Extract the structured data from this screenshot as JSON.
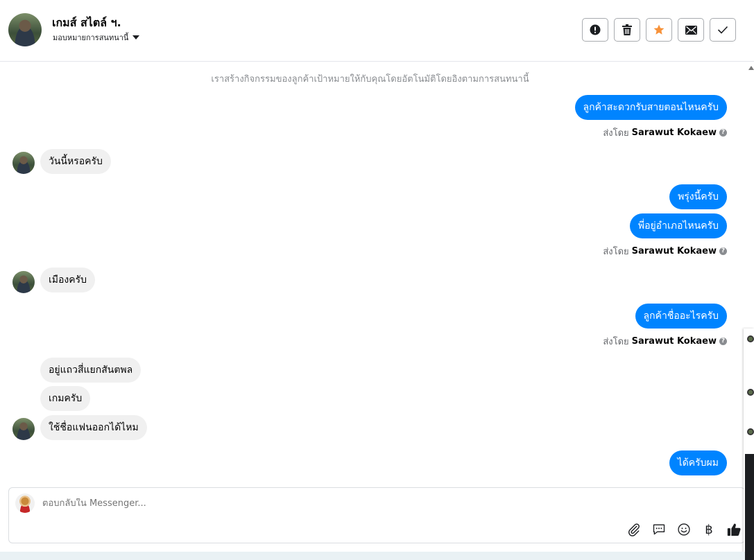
{
  "header": {
    "contact_name": "เกมส์ สไตล์ ฯ.",
    "assign_label": "มอบหมายการสนทนานี้",
    "actions": [
      {
        "name": "spam-button",
        "icon": "exclamation-icon"
      },
      {
        "name": "delete-button",
        "icon": "trash-icon"
      },
      {
        "name": "star-button",
        "icon": "star-icon"
      },
      {
        "name": "mark-unread-button",
        "icon": "envelope-icon"
      },
      {
        "name": "done-button",
        "icon": "checkmark-icon"
      }
    ],
    "star_color": "#f7923a"
  },
  "conversation": {
    "notice": "เราสร้างกิจกรรมของลูกค้าเป้าหมายให้กับคุณโดยอัตโนมัติโดยอิงตามการสนทนานี้",
    "messages": [
      {
        "dir": "out",
        "text": "ลูกค้าสะดวกรับสายตอนไหนครับ"
      },
      {
        "dir": "in",
        "text": "วันนี้หรอครับ"
      },
      {
        "dir": "out",
        "text": "พรุ่งนี้ครับ"
      },
      {
        "dir": "out",
        "text": "พี่อยู่อำเภอไหนครับ"
      },
      {
        "dir": "in",
        "text": "เมืองครับ"
      },
      {
        "dir": "out",
        "text": "ลูกค้าชื่ออะไรครับ"
      },
      {
        "dir": "in",
        "text": "อยู่แถวสี่แยกสันตพล"
      },
      {
        "dir": "in",
        "text": "เกมครับ"
      },
      {
        "dir": "in",
        "text": "ใช้ชื่อแฟนออกได้ไหม"
      },
      {
        "dir": "out",
        "text": "ได้ครับผม"
      }
    ],
    "sent_by_prefix": "ส่งโดย",
    "sent_by_name": "Sarawut Kokaew",
    "outgoing_color": "#0084ff",
    "incoming_color": "#f0f0f0"
  },
  "composer": {
    "placeholder": "ตอบกลับใน Messenger...",
    "currency_symbol": "฿",
    "tools": [
      "paperclip-icon",
      "saved-reply-icon",
      "emoji-icon",
      "currency-icon",
      "thumbs-up-icon"
    ]
  }
}
